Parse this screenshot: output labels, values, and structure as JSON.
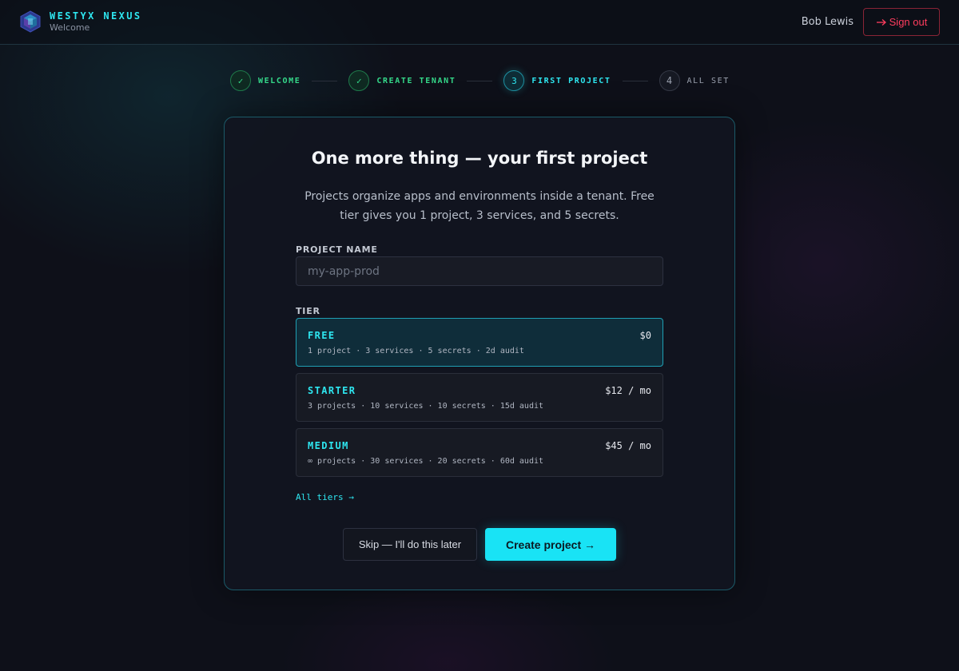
{
  "header": {
    "brand": "WESTYX NEXUS",
    "subtitle": "Welcome",
    "user_name": "Bob Lewis",
    "signout_icon": "arrow-right-icon",
    "signout_label": "Sign out"
  },
  "stepper": {
    "steps": [
      {
        "marker": "✓",
        "label": "WELCOME",
        "state": "done"
      },
      {
        "marker": "✓",
        "label": "CREATE TENANT",
        "state": "done"
      },
      {
        "marker": "3",
        "label": "FIRST PROJECT",
        "state": "active"
      },
      {
        "marker": "4",
        "label": "ALL SET",
        "state": "todo"
      }
    ]
  },
  "card": {
    "title": "One more thing — your first project",
    "description": "Projects organize apps and environments inside a tenant. Free tier gives you 1 project, 3 services, and 5 secrets.",
    "project_name_label": "PROJECT NAME",
    "project_name_placeholder": "my-app-prod",
    "project_name_value": "",
    "tier_label": "TIER",
    "tiers": [
      {
        "name": "FREE",
        "price": "$0",
        "features": "1 project · 3 services · 5 secrets · 2d audit",
        "selected": true
      },
      {
        "name": "STARTER",
        "price": "$12 / mo",
        "features": "3 projects · 10 services · 10 secrets · 15d audit",
        "selected": false
      },
      {
        "name": "MEDIUM",
        "price": "$45 / mo",
        "features": "∞ projects · 30 services · 20 secrets · 60d audit",
        "selected": false
      }
    ],
    "all_tiers_link": "All tiers →",
    "skip_label": "Skip — I'll do this later",
    "create_label": "Create project →"
  },
  "colors": {
    "accent": "#19e3f5",
    "success": "#35d98a",
    "danger": "#ff3d5e",
    "background": "#0e1019"
  }
}
